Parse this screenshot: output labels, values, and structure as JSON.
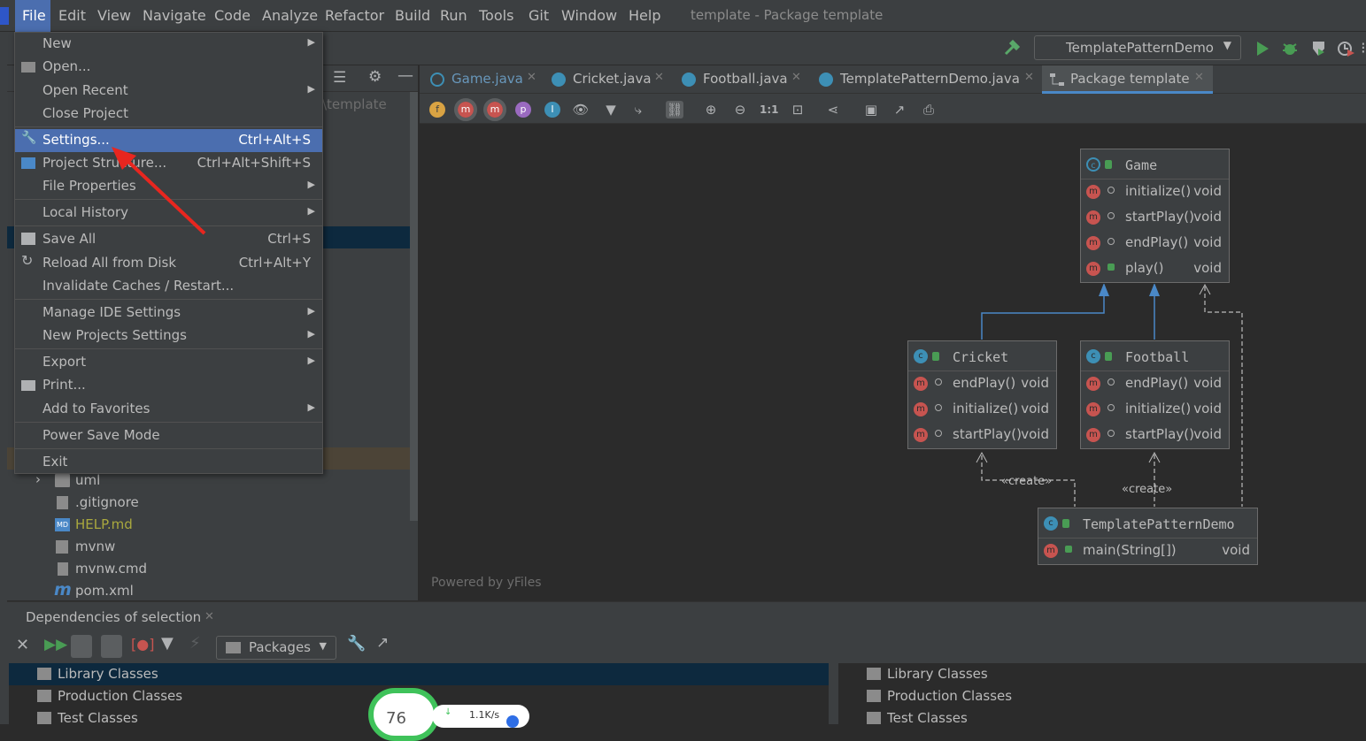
{
  "menubar": {
    "items": [
      "File",
      "Edit",
      "View",
      "Navigate",
      "Code",
      "Analyze",
      "Refactor",
      "Build",
      "Run",
      "Tools",
      "Git",
      "Window",
      "Help"
    ],
    "title": "template - Package template"
  },
  "navbar": {
    "run_config": "TemplatePatternDemo"
  },
  "project": {
    "path_fragment": "\\template",
    "tree": [
      {
        "label": "uml",
        "icon": "folder-icon",
        "expander": "›"
      },
      {
        "label": ".gitignore",
        "icon": "gitignore-file-icon"
      },
      {
        "label": "HELP.md",
        "icon": "markdown-file-icon",
        "color": "#a9a83e"
      },
      {
        "label": "mvnw",
        "icon": "script-file-icon"
      },
      {
        "label": "mvnw.cmd",
        "icon": "text-file-icon"
      },
      {
        "label": "pom.xml",
        "icon": "maven-icon"
      }
    ]
  },
  "tabs": [
    {
      "label": "Game.java",
      "icon": "abstract-class-icon",
      "color": "#6897bb"
    },
    {
      "label": "Cricket.java",
      "icon": "class-icon"
    },
    {
      "label": "Football.java",
      "icon": "class-icon"
    },
    {
      "label": "TemplatePatternDemo.java",
      "icon": "main-class-icon"
    },
    {
      "label": "Package template",
      "icon": "diagram-icon",
      "selected": true
    }
  ],
  "diagram_toolbar": {
    "fields_badge": "f",
    "methods_badge": "m",
    "properties_badge": "p",
    "inner_badge": "I",
    "actual_size": "1:1"
  },
  "diagram": {
    "powered_by": "Powered by yFiles",
    "nodes": {
      "game": {
        "name": "Game",
        "methods": [
          {
            "name": "initialize()",
            "type": "void"
          },
          {
            "name": "startPlay()",
            "type": "void"
          },
          {
            "name": "endPlay()",
            "type": "void"
          },
          {
            "name": "play()",
            "type": "void"
          }
        ]
      },
      "cricket": {
        "name": "Cricket",
        "methods": [
          {
            "name": "endPlay()",
            "type": "void"
          },
          {
            "name": "initialize()",
            "type": "void"
          },
          {
            "name": "startPlay()",
            "type": "void"
          }
        ]
      },
      "football": {
        "name": "Football",
        "methods": [
          {
            "name": "endPlay()",
            "type": "void"
          },
          {
            "name": "initialize()",
            "type": "void"
          },
          {
            "name": "startPlay()",
            "type": "void"
          }
        ]
      },
      "demo": {
        "name": "TemplatePatternDemo",
        "methods": [
          {
            "name": "main(String[])",
            "type": "void"
          }
        ]
      }
    },
    "edge_labels": {
      "create1": "«create»",
      "create2": "«create»"
    }
  },
  "file_menu": {
    "items": [
      {
        "label": "New",
        "submenu": true
      },
      {
        "label": "Open...",
        "icon": "folder-open-icon"
      },
      {
        "label": "Open Recent",
        "submenu": true
      },
      {
        "label": "Close Project"
      },
      {
        "label": "Settings...",
        "shortcut": "Ctrl+Alt+S",
        "icon": "wrench-icon",
        "selected": true
      },
      {
        "label": "Project Structure...",
        "shortcut": "Ctrl+Alt+Shift+S",
        "icon": "project-structure-icon"
      },
      {
        "label": "File Properties",
        "submenu": true
      },
      {
        "label": "Local History",
        "submenu": true
      },
      {
        "label": "Save All",
        "shortcut": "Ctrl+S",
        "icon": "save-icon"
      },
      {
        "label": "Reload All from Disk",
        "shortcut": "Ctrl+Alt+Y",
        "icon": "reload-icon"
      },
      {
        "label": "Invalidate Caches / Restart..."
      },
      {
        "label": "Manage IDE Settings",
        "submenu": true
      },
      {
        "label": "New Projects Settings",
        "submenu": true
      },
      {
        "label": "Export",
        "submenu": true
      },
      {
        "label": "Print...",
        "icon": "print-icon"
      },
      {
        "label": "Add to Favorites",
        "submenu": true
      },
      {
        "label": "Power Save Mode"
      },
      {
        "label": "Exit"
      }
    ]
  },
  "bottom_panel": {
    "title": "Dependencies of selection",
    "scope": "Packages",
    "left_list": [
      "Library Classes",
      "Production Classes",
      "Test Classes"
    ],
    "right_list": [
      "Library Classes",
      "Production Classes",
      "Test Classes"
    ]
  },
  "overlay_widget": {
    "percent": "76",
    "speed": "1.1K/s"
  },
  "colors": {
    "accent": "#4b6eaf",
    "arrow": "#e8261f",
    "inherit_edge": "#4a88c7"
  }
}
